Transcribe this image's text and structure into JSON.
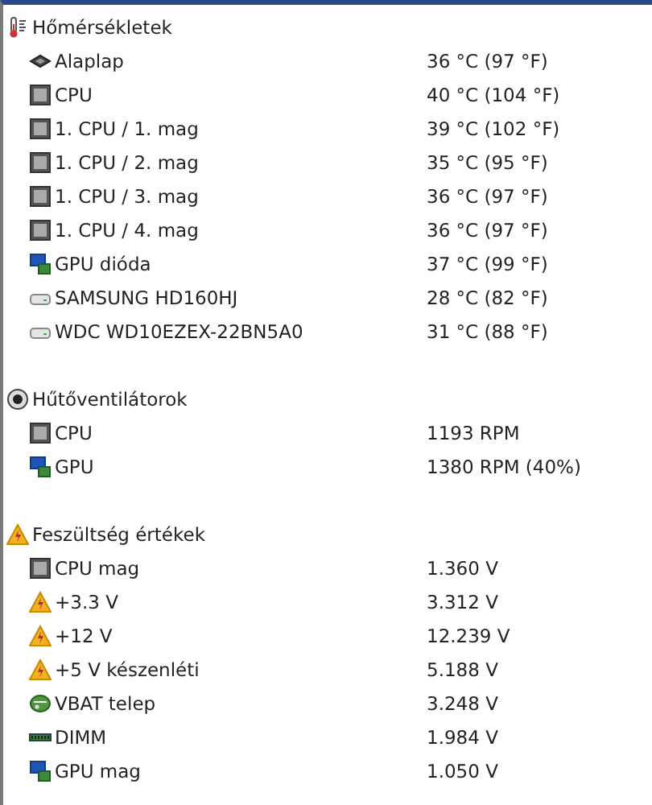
{
  "sections": [
    {
      "kind": "temperature",
      "title": "Hőmérsékletek",
      "items": [
        {
          "kind": "board",
          "label": "Alaplap",
          "value": "36 °C  (97 °F)"
        },
        {
          "kind": "chip",
          "label": "CPU",
          "value": "40 °C  (104 °F)"
        },
        {
          "kind": "chip",
          "label": "1. CPU / 1. mag",
          "value": "39 °C  (102 °F)"
        },
        {
          "kind": "chip",
          "label": "1. CPU / 2. mag",
          "value": "35 °C  (95 °F)"
        },
        {
          "kind": "chip",
          "label": "1. CPU / 3. mag",
          "value": "36 °C  (97 °F)"
        },
        {
          "kind": "chip",
          "label": "1. CPU / 4. mag",
          "value": "36 °C  (97 °F)"
        },
        {
          "kind": "display",
          "label": "GPU dióda",
          "value": "37 °C  (99 °F)"
        },
        {
          "kind": "disk",
          "label": "SAMSUNG HD160HJ",
          "value": "28 °C  (82 °F)"
        },
        {
          "kind": "disk",
          "label": "WDC WD10EZEX-22BN5A0",
          "value": "31 °C  (88 °F)"
        }
      ]
    },
    {
      "kind": "fan",
      "title": "Hűtőventilátorok",
      "items": [
        {
          "kind": "chip",
          "label": "CPU",
          "value": "1193 RPM"
        },
        {
          "kind": "display",
          "label": "GPU",
          "value": "1380 RPM  (40%)"
        }
      ]
    },
    {
      "kind": "voltage",
      "title": "Feszültség értékek",
      "items": [
        {
          "kind": "chip",
          "label": "CPU mag",
          "value": "1.360 V"
        },
        {
          "kind": "warning",
          "label": "+3.3 V",
          "value": "3.312 V"
        },
        {
          "kind": "warning",
          "label": "+12 V",
          "value": "12.239 V"
        },
        {
          "kind": "warning",
          "label": "+5 V készenléti",
          "value": "5.188 V"
        },
        {
          "kind": "battery",
          "label": "VBAT telep",
          "value": "3.248 V"
        },
        {
          "kind": "memory",
          "label": "DIMM",
          "value": "1.984 V"
        },
        {
          "kind": "display",
          "label": "GPU mag",
          "value": "1.050 V"
        }
      ]
    }
  ]
}
